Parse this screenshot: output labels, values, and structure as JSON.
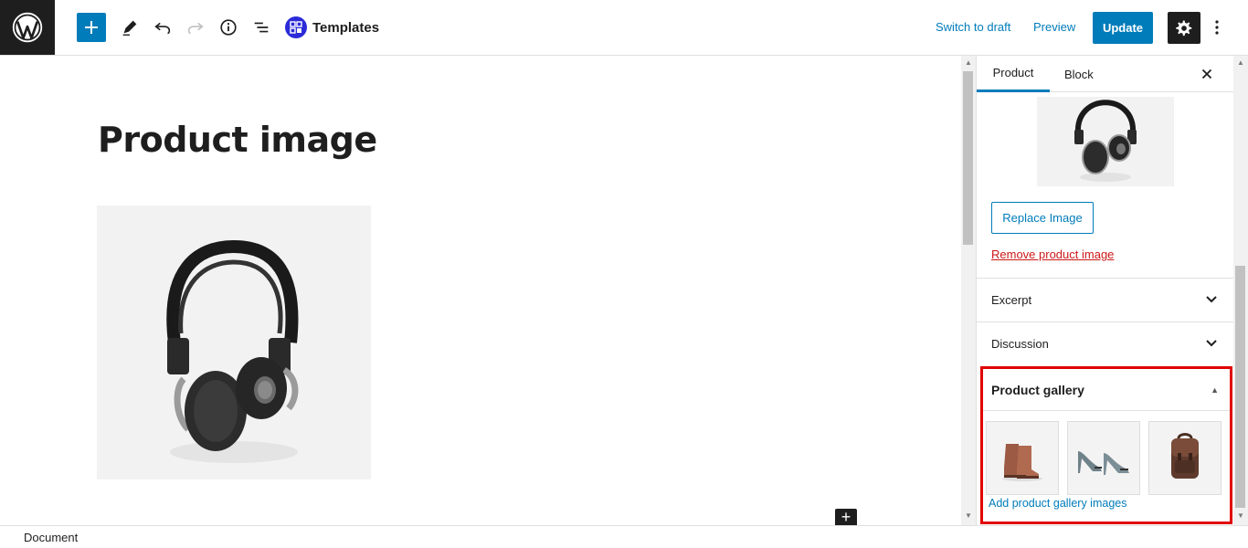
{
  "toolbar": {
    "wp_logo_icon": "wordpress-logo-icon",
    "add_block_icon": "plus-icon",
    "tools_icon": "pencil-icon",
    "undo_icon": "undo-icon",
    "redo_icon": "redo-icon",
    "details_icon": "info-icon",
    "list_view_icon": "list-view-icon",
    "templates_label": "Templates",
    "switch_to_draft": "Switch to draft",
    "preview": "Preview",
    "update": "Update",
    "settings_icon": "gear-icon",
    "more_icon": "kebab-icon",
    "accent": "#007cba"
  },
  "editor": {
    "post_title": "Product image",
    "image_alt_icon": "headphones-image"
  },
  "sidebar": {
    "tabs": [
      {
        "label": "Product"
      },
      {
        "label": "Block"
      }
    ],
    "replace_image": "Replace Image",
    "remove_image": "Remove product image",
    "panels": [
      {
        "label": "Excerpt"
      },
      {
        "label": "Discussion"
      }
    ],
    "gallery": {
      "title": "Product gallery",
      "images": [
        "boots-image",
        "heels-image",
        "backpack-image"
      ],
      "add_link": "Add product gallery images",
      "highlight_color": "#e00000"
    }
  },
  "footer": {
    "breadcrumb": "Document"
  }
}
